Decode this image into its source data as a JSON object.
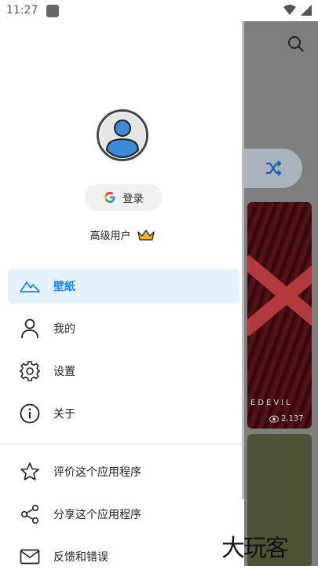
{
  "status_bar": {
    "time": "11:27"
  },
  "drawer": {
    "login_label": "登录",
    "premium_label": "高级用户",
    "nav_items": [
      {
        "label": "壁紙",
        "icon": "mountain-icon",
        "active": true
      },
      {
        "label": "我的",
        "icon": "person-icon"
      },
      {
        "label": "设置",
        "icon": "gear-icon"
      },
      {
        "label": "关于",
        "icon": "info-icon"
      }
    ],
    "secondary_items": [
      {
        "label": "评价这个应用程序",
        "icon": "star-icon"
      },
      {
        "label": "分享这个应用程序",
        "icon": "share-icon"
      },
      {
        "label": "反馈和错误",
        "icon": "mail-icon"
      }
    ]
  },
  "background_app": {
    "card1_label": "EDEVIL",
    "card1_views": "2,137"
  },
  "watermark": "大玩客",
  "colors": {
    "accent": "#1e88e5",
    "active_bg": "#e3f2fd"
  }
}
